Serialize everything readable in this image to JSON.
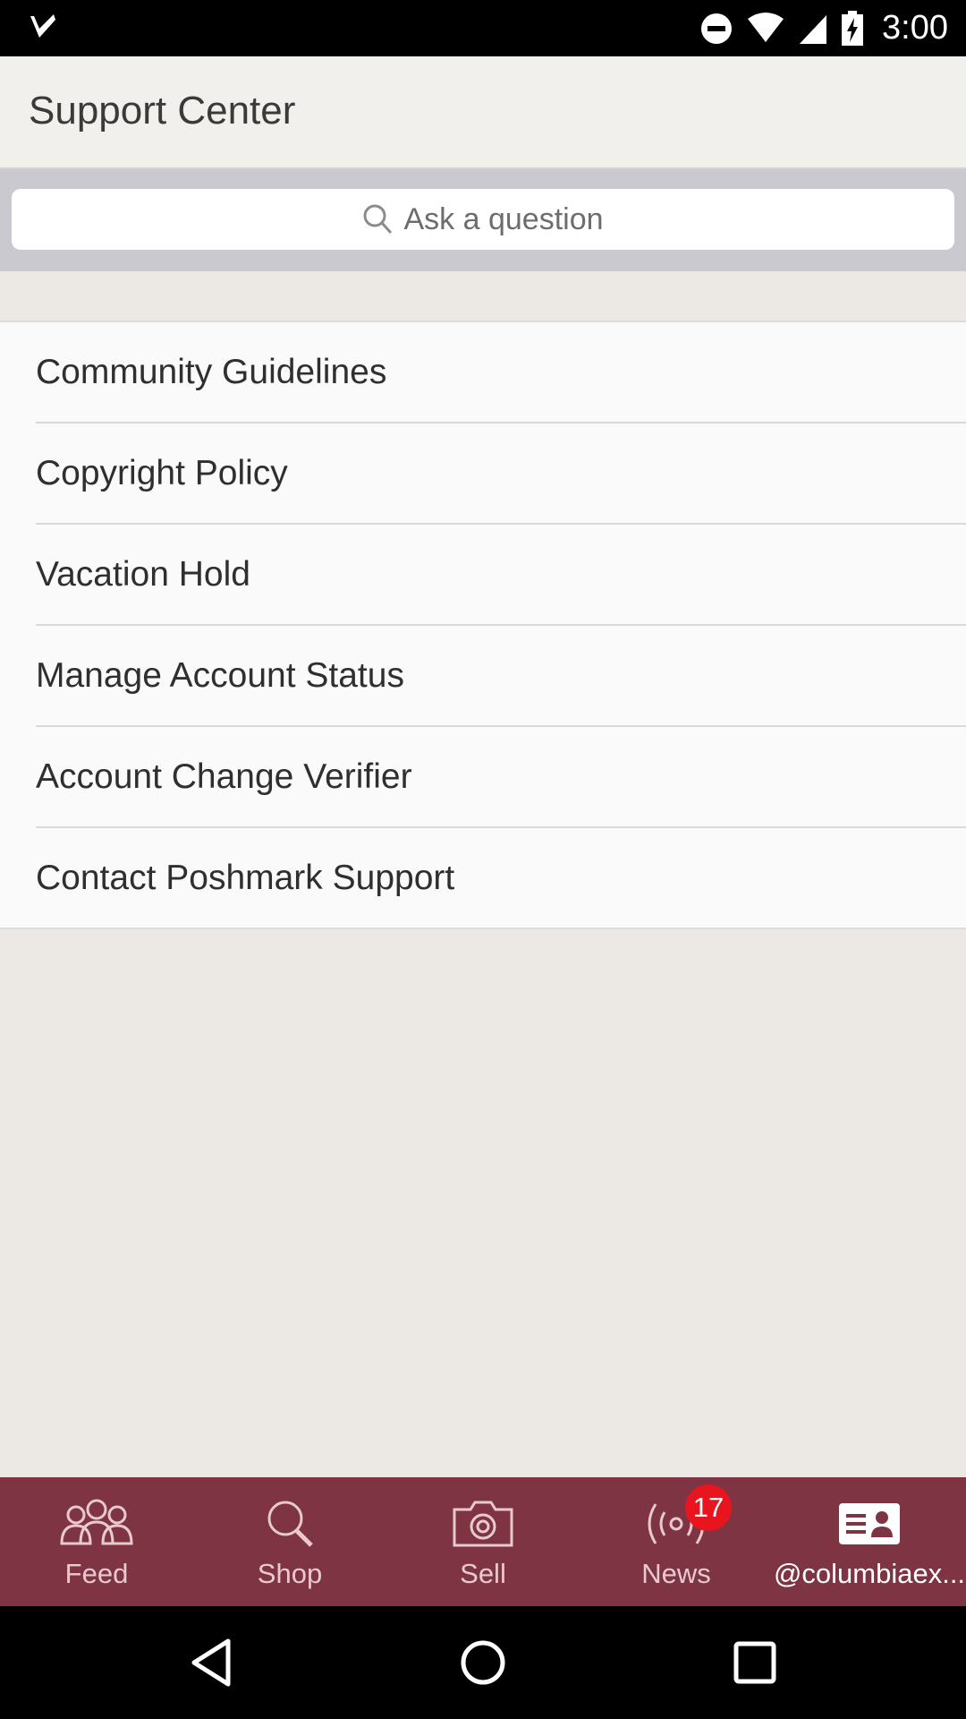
{
  "status_bar": {
    "time": "3:00",
    "icons": [
      "notification-check-icon",
      "do-not-disturb-icon",
      "wifi-icon",
      "signal-icon",
      "battery-charging-icon"
    ]
  },
  "app_bar": {
    "title": "Support Center"
  },
  "search": {
    "placeholder": "Ask a question",
    "icon": "search-icon"
  },
  "menu": {
    "items": [
      {
        "label": "Community Guidelines"
      },
      {
        "label": "Copyright Policy"
      },
      {
        "label": "Vacation Hold"
      },
      {
        "label": "Manage Account Status"
      },
      {
        "label": "Account Change Verifier"
      },
      {
        "label": "Contact Poshmark Support"
      }
    ]
  },
  "bottom_nav": {
    "tabs": [
      {
        "label": "Feed",
        "icon": "people-icon"
      },
      {
        "label": "Shop",
        "icon": "search-icon"
      },
      {
        "label": "Sell",
        "icon": "camera-icon"
      },
      {
        "label": "News",
        "icon": "broadcast-icon",
        "badge": "17"
      },
      {
        "label": "@columbiaex...",
        "icon": "profile-card-icon",
        "active": true
      }
    ]
  },
  "colors": {
    "nav_background": "#7e3442",
    "badge": "#e8141e"
  },
  "system_nav": {
    "buttons": [
      "back-icon",
      "home-icon",
      "recents-icon"
    ]
  }
}
